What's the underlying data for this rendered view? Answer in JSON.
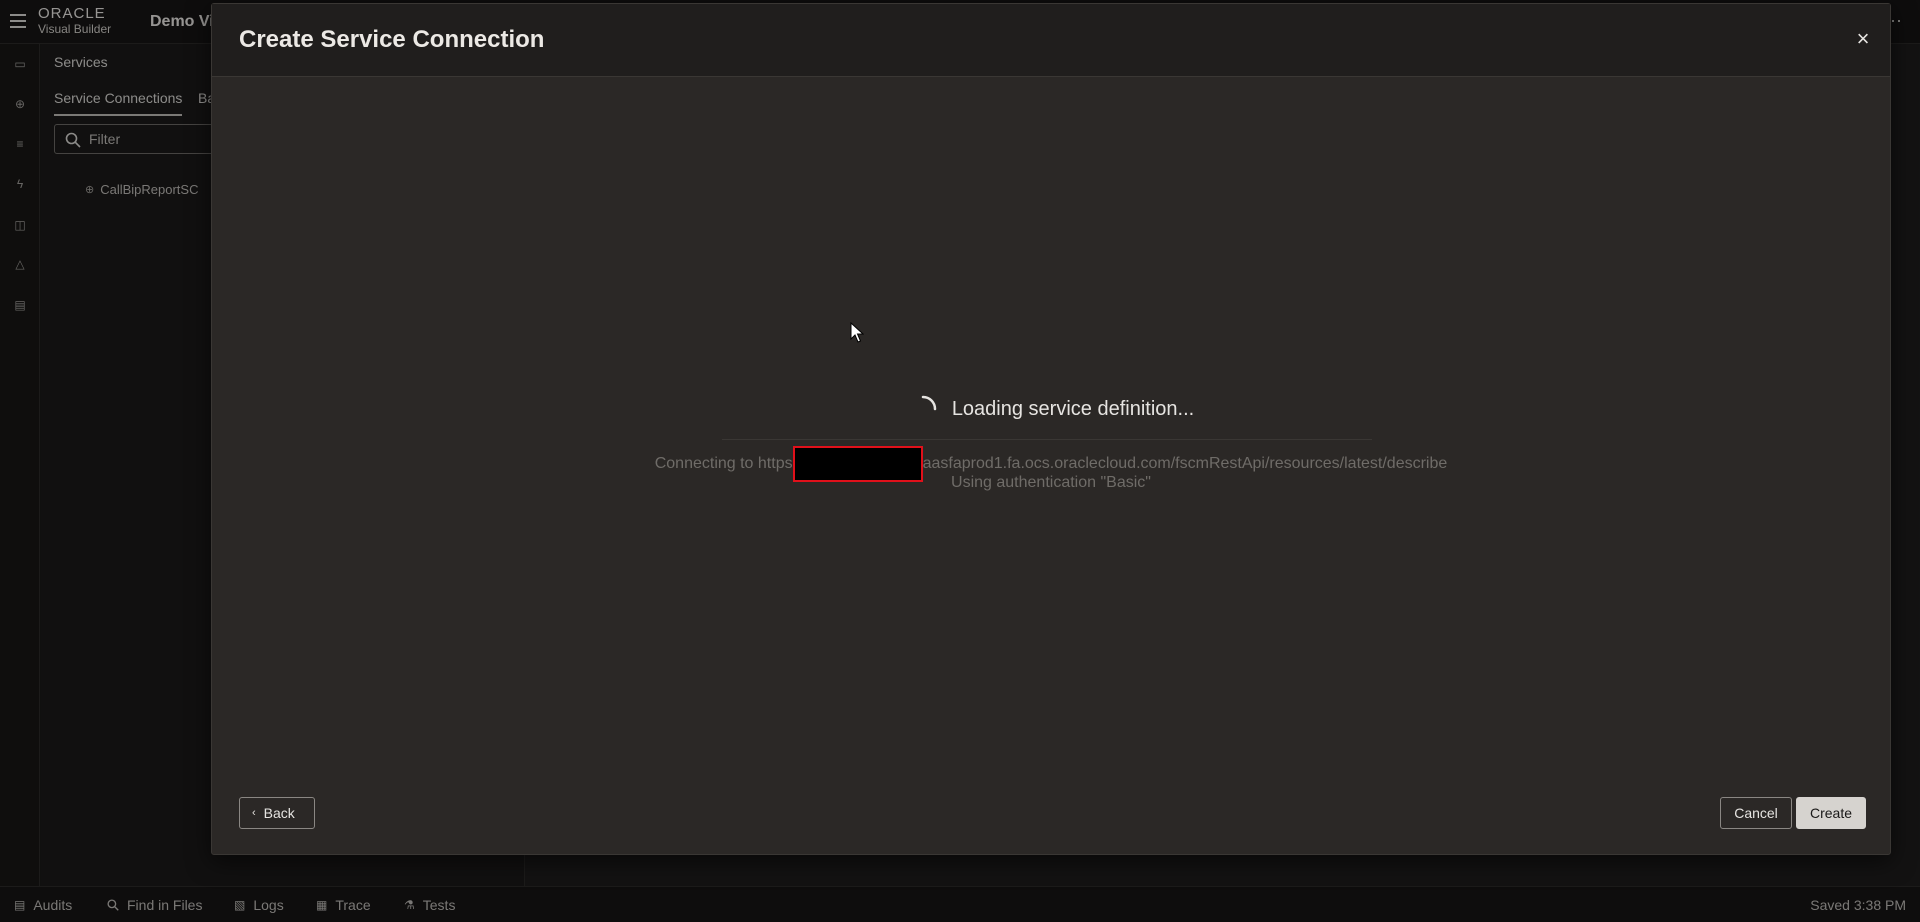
{
  "window": {
    "logo_line1": "ORACLE",
    "logo_line2": "Visual Builder",
    "app_title": "Demo Vi",
    "more_glyph": "···"
  },
  "rail": {
    "items": [
      {
        "name": "web-apps-icon",
        "glyph": "▭"
      },
      {
        "name": "services-icon",
        "glyph": "⊕"
      },
      {
        "name": "business-objects-icon",
        "glyph": "≡"
      },
      {
        "name": "processes-icon",
        "glyph": "ϟ"
      },
      {
        "name": "components-icon",
        "glyph": "◫"
      },
      {
        "name": "layouts-icon",
        "glyph": "△"
      },
      {
        "name": "source-icon",
        "glyph": "▤"
      }
    ]
  },
  "navigator": {
    "title": "Services",
    "tabs": [
      {
        "label": "Service Connections",
        "active": true
      },
      {
        "label": "Ba",
        "active": false
      }
    ],
    "filter_placeholder": "Filter",
    "tree_items": [
      {
        "label": "CallBipReportSC"
      }
    ]
  },
  "dialog": {
    "title": "Create Service Connection",
    "close_glyph": "×",
    "loading_text": "Loading service definition...",
    "connect_prefix": "Connecting to https",
    "connect_suffix": "aasfaprod1.fa.ocs.oraclecloud.com/fscmRestApi/resources/latest/describe",
    "auth_text": "Using authentication \"Basic\"",
    "back_label": "Back",
    "cancel_label": "Cancel",
    "create_label": "Create"
  },
  "statusbar": {
    "items": [
      {
        "label": "Audits",
        "icon": "audits-icon"
      },
      {
        "label": "Find in Files",
        "icon": "search-icon"
      },
      {
        "label": "Logs",
        "icon": "logs-icon"
      },
      {
        "label": "Trace",
        "icon": "trace-icon"
      },
      {
        "label": "Tests",
        "icon": "tests-icon"
      }
    ],
    "saved_text": "Saved 3:38 PM"
  },
  "colors": {
    "background": "#1a1918",
    "dialog": "#2b2826",
    "primary_button": "#d6d3cf",
    "redaction_border": "#e0101a"
  }
}
